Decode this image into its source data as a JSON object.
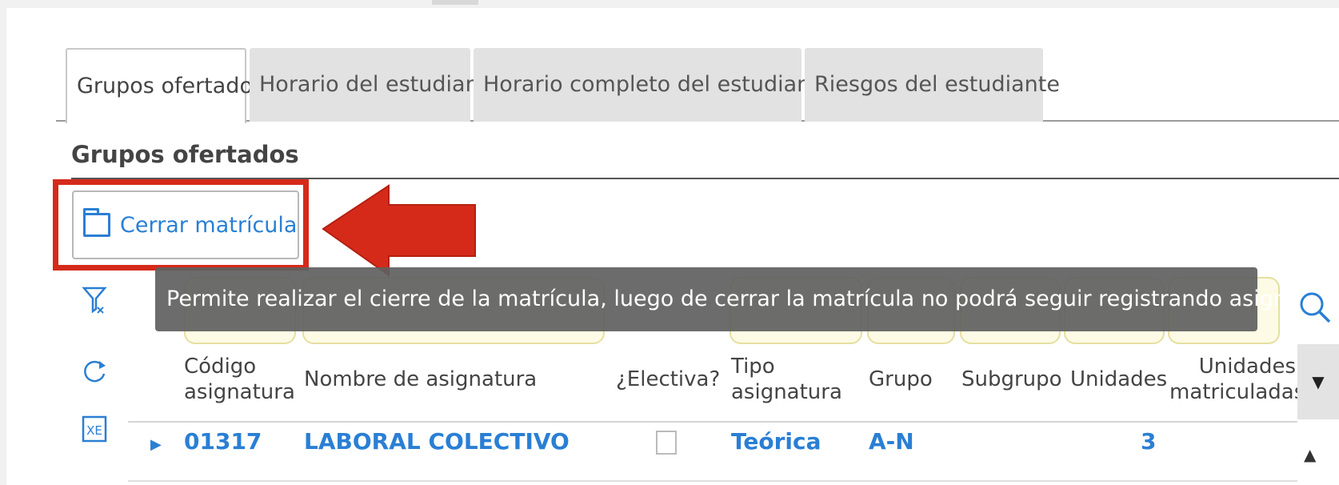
{
  "tabs": [
    {
      "label": "Grupos ofertados"
    },
    {
      "label": "Horario del estudiante"
    },
    {
      "label": "Horario completo del estudiante"
    },
    {
      "label": "Riesgos del estudiante"
    }
  ],
  "section": {
    "title": "Grupos ofertados"
  },
  "toolbar": {
    "cerrar_label": "Cerrar matrícula",
    "cerrar_icon": "folder-icon"
  },
  "tooltip": {
    "text": "Permite realizar el cierre de la matrícula, luego de cerrar la matrícula no podrá seguir registrando asignaturas."
  },
  "tools": {
    "icons": [
      "filter-icon",
      "refresh-icon",
      "excel-export-icon",
      "search-icon"
    ]
  },
  "grid": {
    "columns": [
      {
        "line1": "Código",
        "line2": "asignatura"
      },
      {
        "line1": "Nombre de asignatura",
        "line2": ""
      },
      {
        "line1": "¿Electiva?",
        "line2": ""
      },
      {
        "line1": "Tipo",
        "line2": "asignatura"
      },
      {
        "line1": "Grupo",
        "line2": ""
      },
      {
        "line1": "Subgrupo",
        "line2": ""
      },
      {
        "line1": "Unidades",
        "line2": ""
      },
      {
        "line1": "Unidades",
        "line2": "matriculadas"
      }
    ],
    "rows": [
      {
        "codigo": "01317",
        "nombre": "LABORAL COLECTIVO",
        "electiva": false,
        "tipo": "Teórica",
        "grupo": "A-N",
        "subgrupo": "",
        "unidades": "3",
        "unidades_matriculadas": ""
      }
    ]
  },
  "colors": {
    "accent": "#2a7fd4",
    "highlight": "#d52a1a",
    "tooltip_bg": "#5f5f5f",
    "filter_bg": "#fdfbe5"
  }
}
